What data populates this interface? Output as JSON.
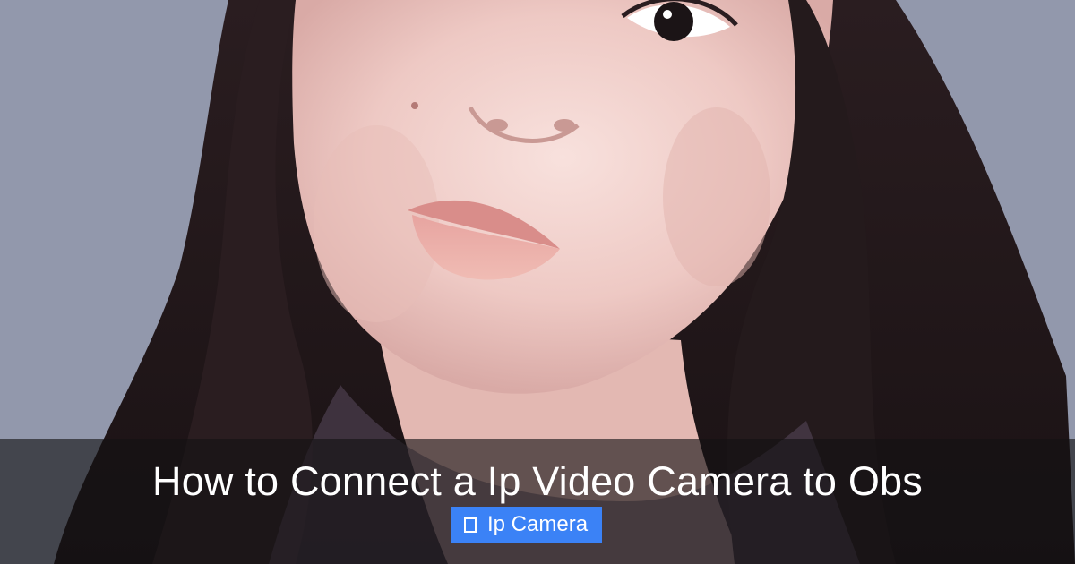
{
  "article": {
    "title": "How to Connect a Ip Video Camera to Obs",
    "category_icon": "tag-icon",
    "category_label": "Ip Camera"
  },
  "colors": {
    "badge_background": "#3b82f6",
    "overlay": "#141214",
    "title_text": "#ffffff"
  }
}
